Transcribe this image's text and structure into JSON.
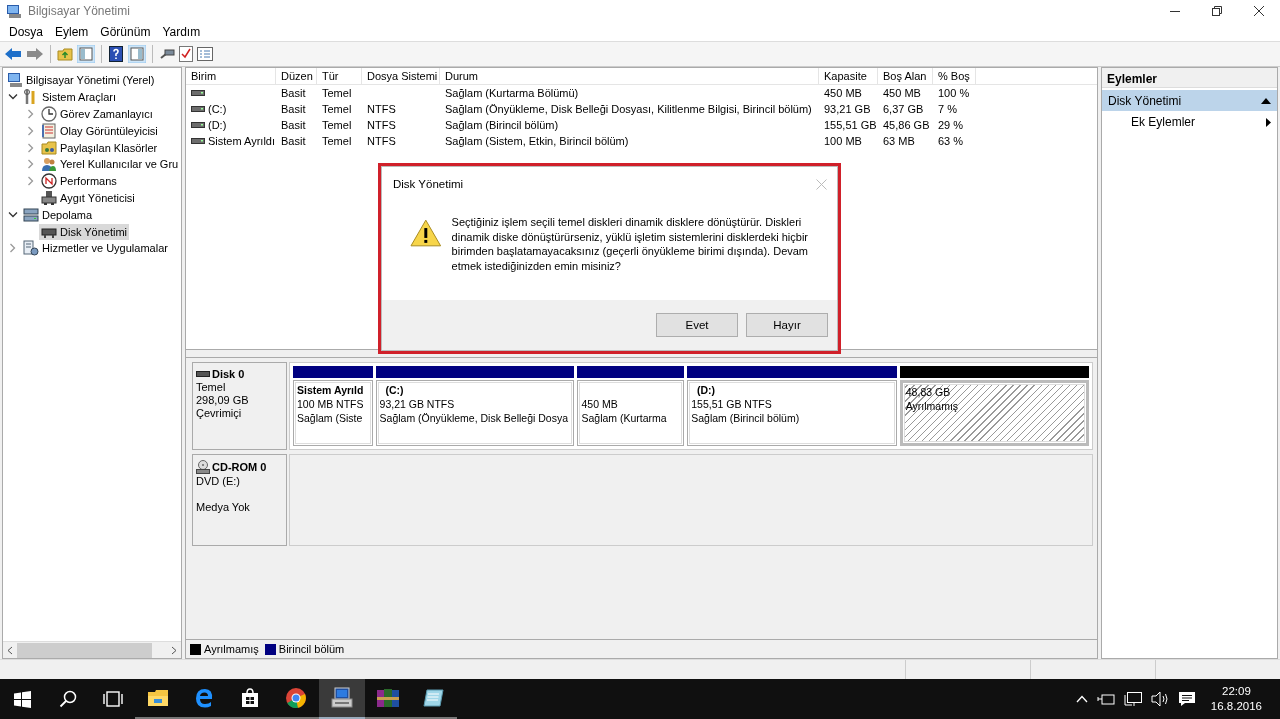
{
  "window": {
    "title": "Bilgisayar Yönetimi"
  },
  "menu": [
    "Dosya",
    "Eylem",
    "Görünüm",
    "Yardım"
  ],
  "tree": [
    {
      "label": "Bilgisayar Yönetimi (Yerel)",
      "kind": "root",
      "selected": false,
      "children": [
        {
          "label": "Sistem Araçları",
          "kind": "branch",
          "expanded": true,
          "selected": false,
          "children": [
            {
              "label": "Görev Zamanlayıcı",
              "kind": "branch",
              "expanded": false,
              "selected": false
            },
            {
              "label": "Olay Görüntüleyicisi",
              "kind": "branch",
              "expanded": false,
              "selected": false
            },
            {
              "label": "Paylaşılan Klasörler",
              "kind": "branch",
              "expanded": false,
              "selected": false
            },
            {
              "label": "Yerel Kullanıcılar ve Gru",
              "kind": "branch",
              "expanded": false,
              "selected": false
            },
            {
              "label": "Performans",
              "kind": "branch",
              "expanded": false,
              "selected": false
            },
            {
              "label": "Aygıt Yöneticisi",
              "kind": "leaf",
              "selected": false
            }
          ]
        },
        {
          "label": "Depolama",
          "kind": "branch",
          "expanded": true,
          "selected": false,
          "children": [
            {
              "label": "Disk Yönetimi",
              "kind": "leaf",
              "selected": true
            }
          ]
        },
        {
          "label": "Hizmetler ve Uygulamalar",
          "kind": "branch",
          "expanded": false,
          "selected": false
        }
      ]
    }
  ],
  "table": {
    "columns": [
      "Birim",
      "Düzen",
      "Tür",
      "Dosya Sistemi",
      "Durum",
      "Kapasite",
      "Boş Alan",
      "% Boş"
    ],
    "rows": [
      {
        "selected": false,
        "layout": "Basit",
        "type": "Temel",
        "status": "Sağlam (Kurtarma Bölümü)",
        "capacity": "450 MB",
        "free": "450 MB",
        "percent_free": "100 %"
      },
      {
        "selected": false,
        "volume": "(C:)",
        "layout": "Basit",
        "type": "Temel",
        "file_system": "NTFS",
        "status": "Sağlam (Önyükleme, Disk Belleği Dosyası, Kilitlenme Bilgisi, Birincil bölüm)",
        "capacity": "93,21 GB",
        "free": "6,37 GB",
        "percent_free": "7 %"
      },
      {
        "selected": false,
        "volume": "(D:)",
        "layout": "Basit",
        "type": "Temel",
        "file_system": "NTFS",
        "status": "Sağlam (Birincil bölüm)",
        "capacity": "155,51 GB",
        "free": "45,86 GB",
        "percent_free": "29 %"
      },
      {
        "selected": false,
        "volume": "Sistem Ayrıldı",
        "layout": "Basit",
        "type": "Temel",
        "file_system": "NTFS",
        "status": "Sağlam (Sistem, Etkin, Birincil bölüm)",
        "capacity": "100 MB",
        "free": "63 MB",
        "percent_free": "63 %"
      }
    ]
  },
  "disks": [
    {
      "name": "Disk 0",
      "kind": "disk",
      "type": "Temel",
      "size": "298,09 GB",
      "status": "Çevrimiçi",
      "partitions": [
        {
          "kind": "primary",
          "color": "#000080",
          "title": "Sistem Ayrıld",
          "size": "100 MB NTFS",
          "status": "Sağlam (Siste"
        },
        {
          "kind": "primary",
          "color": "#000080",
          "title": "(C:)",
          "size": "93,21 GB NTFS",
          "status": "Sağlam (Önyükleme, Disk Belleği Dosya"
        },
        {
          "kind": "primary",
          "color": "#000080",
          "size": "450 MB",
          "status": "Sağlam (Kurtarma"
        },
        {
          "kind": "primary",
          "color": "#000080",
          "title": "(D:)",
          "size": "155,51 GB NTFS",
          "status": "Sağlam (Birincil bölüm)"
        },
        {
          "kind": "unallocated",
          "color": "#000000",
          "size": "48,83 GB",
          "status": "Ayrılmamış"
        }
      ]
    },
    {
      "name": "CD-ROM 0",
      "kind": "cdrom",
      "type": "DVD (E:)",
      "status": "Medya Yok"
    }
  ],
  "legend": [
    {
      "label": "Ayrılmamış",
      "color": "#000000"
    },
    {
      "label": "Birincil bölüm",
      "color": "#000080"
    }
  ],
  "actions": {
    "title": "Eylemler",
    "sections": [
      {
        "label": "Disk Yönetimi",
        "expanded": true,
        "items": [
          {
            "label": "Ek Eylemler",
            "submenu": true
          }
        ]
      }
    ]
  },
  "dialog": {
    "title": "Disk Yönetimi",
    "message": "Seçtiğiniz işlem seçili temel diskleri dinamik disklere dönüştürür. Diskleri dinamik diske dönüştürürseniz, yüklü işletim sistemlerini disklerdeki hiçbir birimden başlatamayacaksınız (geçerli önyükleme birimi dışında). Devam etmek istediğinizden emin misiniz?",
    "buttons": [
      "Evet",
      "Hayır"
    ]
  },
  "taskbar": {
    "apps": [
      {
        "kind": "explorer",
        "selected": false
      },
      {
        "kind": "edge",
        "selected": false
      },
      {
        "kind": "store",
        "selected": false
      },
      {
        "kind": "chrome",
        "selected": false
      },
      {
        "kind": "management",
        "selected": true
      },
      {
        "kind": "archiver",
        "selected": false
      },
      {
        "kind": "notepad",
        "selected": false
      }
    ],
    "time": "22:09",
    "date": "16.8.2016"
  }
}
